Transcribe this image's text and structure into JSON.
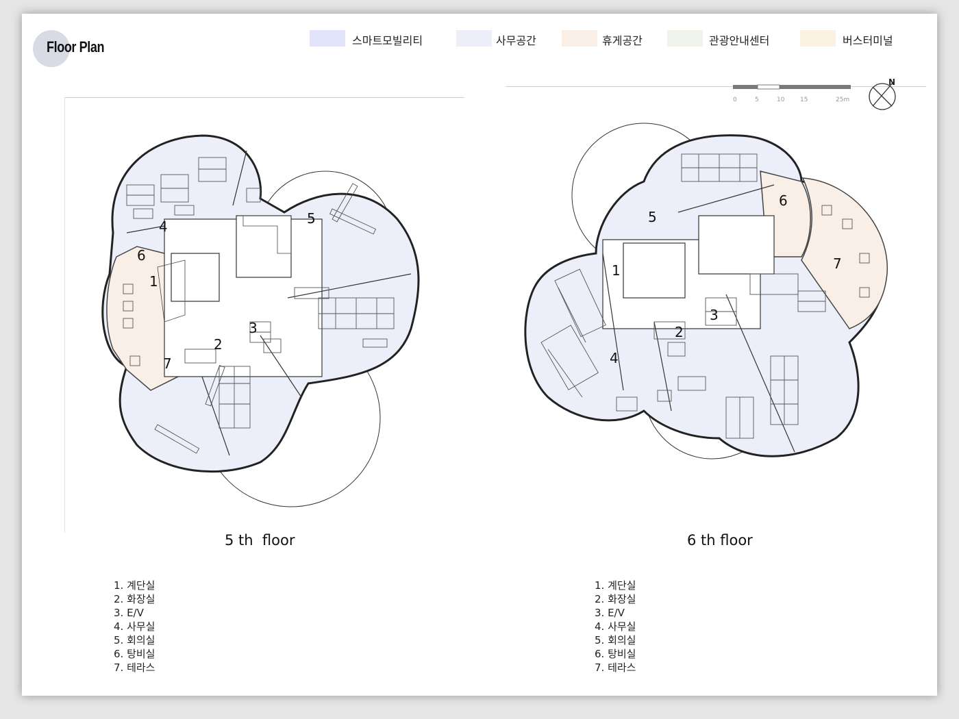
{
  "header": {
    "title": "Floor Plan"
  },
  "legend": [
    {
      "label": "스마트모빌리티",
      "color": "#e2e4fb"
    },
    {
      "label": "사무공간",
      "color": "#eceff9"
    },
    {
      "label": "휴게공간",
      "color": "#f9efe6"
    },
    {
      "label": "관광안내센터",
      "color": "#f1f4ea"
    },
    {
      "label": "버스터미널",
      "color": "#fbf2e2"
    }
  ],
  "scale_bar": {
    "ticks": [
      "0",
      "5",
      "10",
      "15",
      "25m"
    ],
    "north": "N"
  },
  "plans": {
    "fifth": {
      "caption": "5 th  floor",
      "room_numbers": [
        "1",
        "2",
        "3",
        "4",
        "5",
        "6",
        "7"
      ],
      "rooms": [
        "1. 계단실",
        "2. 화장실",
        "3. E/V",
        "4. 사무실",
        "5. 회의실",
        "6. 탕비실",
        "7. 테라스"
      ]
    },
    "sixth": {
      "caption": "6 th floor",
      "room_numbers": [
        "1",
        "2",
        "3",
        "4",
        "5",
        "6",
        "7"
      ],
      "rooms": [
        "1. 계단실",
        "2. 화장실",
        "3. E/V",
        "4. 사무실",
        "5. 회의실",
        "6. 탕비실",
        "7. 테라스"
      ]
    }
  }
}
